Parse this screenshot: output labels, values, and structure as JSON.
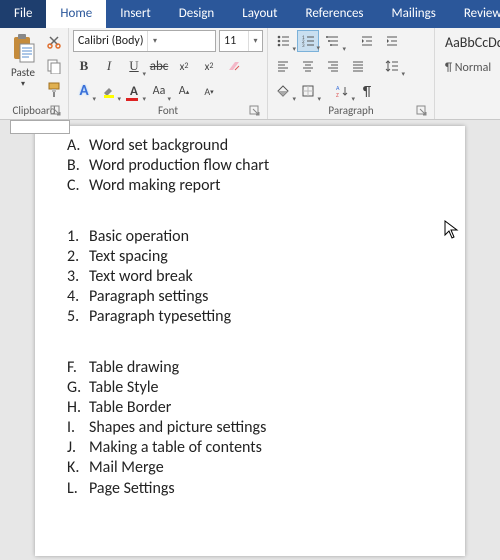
{
  "tabs": {
    "file": "File",
    "home": "Home",
    "insert": "Insert",
    "design": "Design",
    "layout": "Layout",
    "references": "References",
    "mailings": "Mailings",
    "review": "Review"
  },
  "clipboard": {
    "paste": "Paste",
    "label": "Clipboard"
  },
  "font": {
    "name": "Calibri (Body)",
    "size": "11",
    "label": "Font"
  },
  "paragraph": {
    "label": "Paragraph"
  },
  "styles": {
    "preview": "AaBbCcDd",
    "name": "¶ Normal"
  },
  "doc": {
    "g1": [
      {
        "mk": "A.",
        "t": "Word set background"
      },
      {
        "mk": "B.",
        "t": "Word production flow chart"
      },
      {
        "mk": "C.",
        "t": "Word making report"
      }
    ],
    "g2": [
      {
        "mk": "1.",
        "t": "Basic operation"
      },
      {
        "mk": "2.",
        "t": "Text spacing"
      },
      {
        "mk": "3.",
        "t": "Text word break"
      },
      {
        "mk": "4.",
        "t": "Paragraph settings"
      },
      {
        "mk": "5.",
        "t": "Paragraph typesetting"
      }
    ],
    "g3": [
      {
        "mk": "F.",
        "t": "Table drawing"
      },
      {
        "mk": "G.",
        "t": "Table Style"
      },
      {
        "mk": "H.",
        "t": "Table Border"
      },
      {
        "mk": "I.",
        "t": "Shapes and picture settings"
      },
      {
        "mk": "J.",
        "t": "Making a table of contents"
      },
      {
        "mk": "K.",
        "t": "Mail Merge"
      },
      {
        "mk": "L.",
        "t": "Page Settings"
      }
    ]
  }
}
